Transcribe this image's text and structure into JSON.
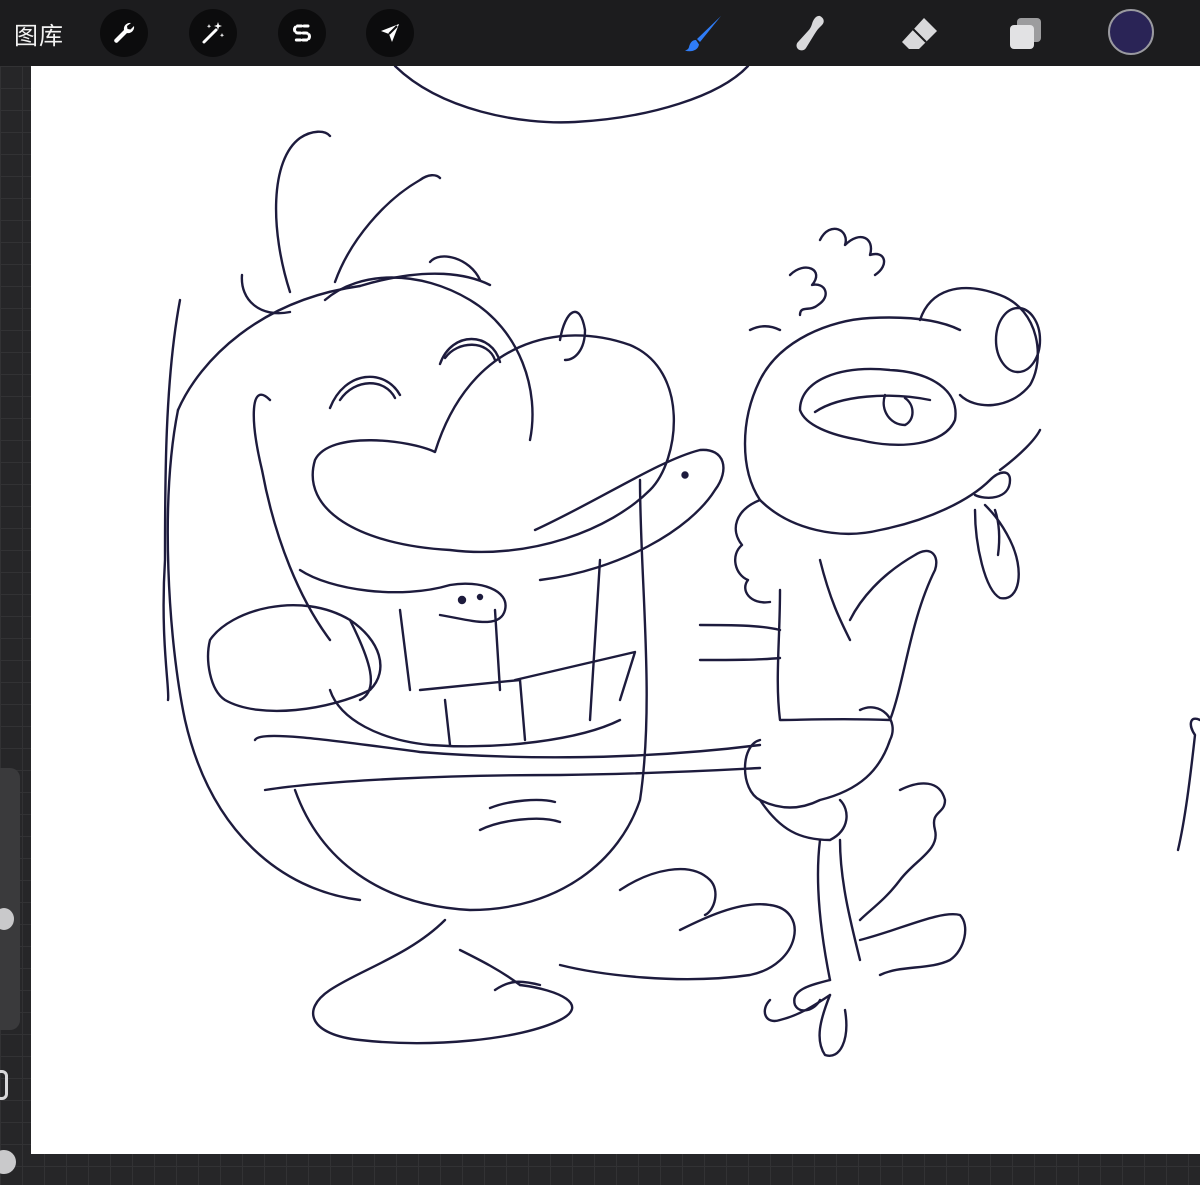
{
  "toolbar": {
    "gallery_label": "图库",
    "left_tools": [
      "wrench-icon",
      "magic-wand-icon",
      "selection-s-icon",
      "transform-arrow-icon"
    ],
    "right_tools": [
      "brush-icon",
      "smudge-icon",
      "eraser-icon",
      "layers-icon"
    ],
    "active_tool": "brush-icon",
    "active_tool_color": "#2f7cf6",
    "current_color": "#2a2456"
  },
  "canvas": {
    "background": "#ffffff",
    "ink_color": "#1d1b3d",
    "content": "cartoon-sketch-line-art"
  },
  "sidebar": {
    "brush_size_icon": "slider-knob",
    "modify_button_icon": "square-button-icon",
    "opacity_icon": "slider-knob"
  }
}
